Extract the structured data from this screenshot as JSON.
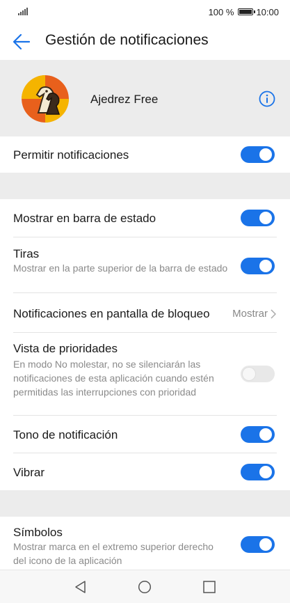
{
  "status_bar": {
    "battery": "100 %",
    "time": "10:00"
  },
  "app_bar": {
    "title": "Gestión de notificaciones"
  },
  "app_header": {
    "app_name": "Ajedrez Free"
  },
  "settings": {
    "allow": {
      "title": "Permitir notificaciones",
      "enabled": true
    },
    "status_bar": {
      "title": "Mostrar en barra de estado",
      "enabled": true
    },
    "banners": {
      "title": "Tiras",
      "subtitle": "Mostrar en la parte superior de la barra de estado",
      "enabled": true
    },
    "lock_screen": {
      "title": "Notificaciones en pantalla de bloqueo",
      "value": "Mostrar"
    },
    "priority": {
      "title": "Vista de prioridades",
      "subtitle": "En modo No molestar, no se silenciarán las notificaciones de esta aplicación cuando estén permitidas las interrupciones con prioridad",
      "enabled": false
    },
    "tone": {
      "title": "Tono de notificación",
      "enabled": true
    },
    "vibrate": {
      "title": "Vibrar",
      "enabled": true
    },
    "badges": {
      "title": "Símbolos",
      "subtitle": "Mostrar marca en el extremo superior derecho del icono de la aplicación",
      "enabled": true
    }
  },
  "colors": {
    "accent": "#1a73e8",
    "section_bg": "#ececec"
  },
  "icons": {
    "back": "arrow-left",
    "info": "info-circle",
    "chevron": "chevron-right",
    "nav_back": "triangle-back",
    "nav_home": "circle-home",
    "nav_recent": "square-recent"
  }
}
